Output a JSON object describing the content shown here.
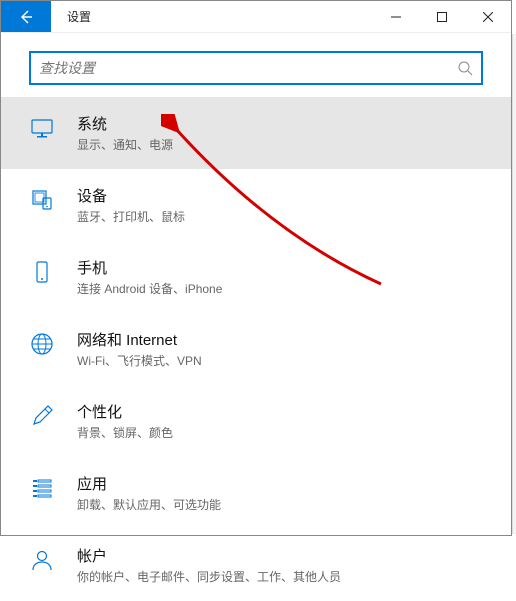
{
  "title": "设置",
  "search": {
    "placeholder": "查找设置"
  },
  "items": [
    {
      "key": "system",
      "title": "系统",
      "sub": "显示、通知、电源",
      "selected": true
    },
    {
      "key": "devices",
      "title": "设备",
      "sub": "蓝牙、打印机、鼠标",
      "selected": false
    },
    {
      "key": "phone",
      "title": "手机",
      "sub": "连接 Android 设备、iPhone",
      "selected": false
    },
    {
      "key": "network",
      "title": "网络和 Internet",
      "sub": "Wi-Fi、飞行模式、VPN",
      "selected": false
    },
    {
      "key": "personalization",
      "title": "个性化",
      "sub": "背景、锁屏、颜色",
      "selected": false
    },
    {
      "key": "apps",
      "title": "应用",
      "sub": "卸载、默认应用、可选功能",
      "selected": false
    },
    {
      "key": "accounts",
      "title": "帐户",
      "sub": "你的帐户、电子邮件、同步设置、工作、其他人员",
      "selected": false
    }
  ]
}
